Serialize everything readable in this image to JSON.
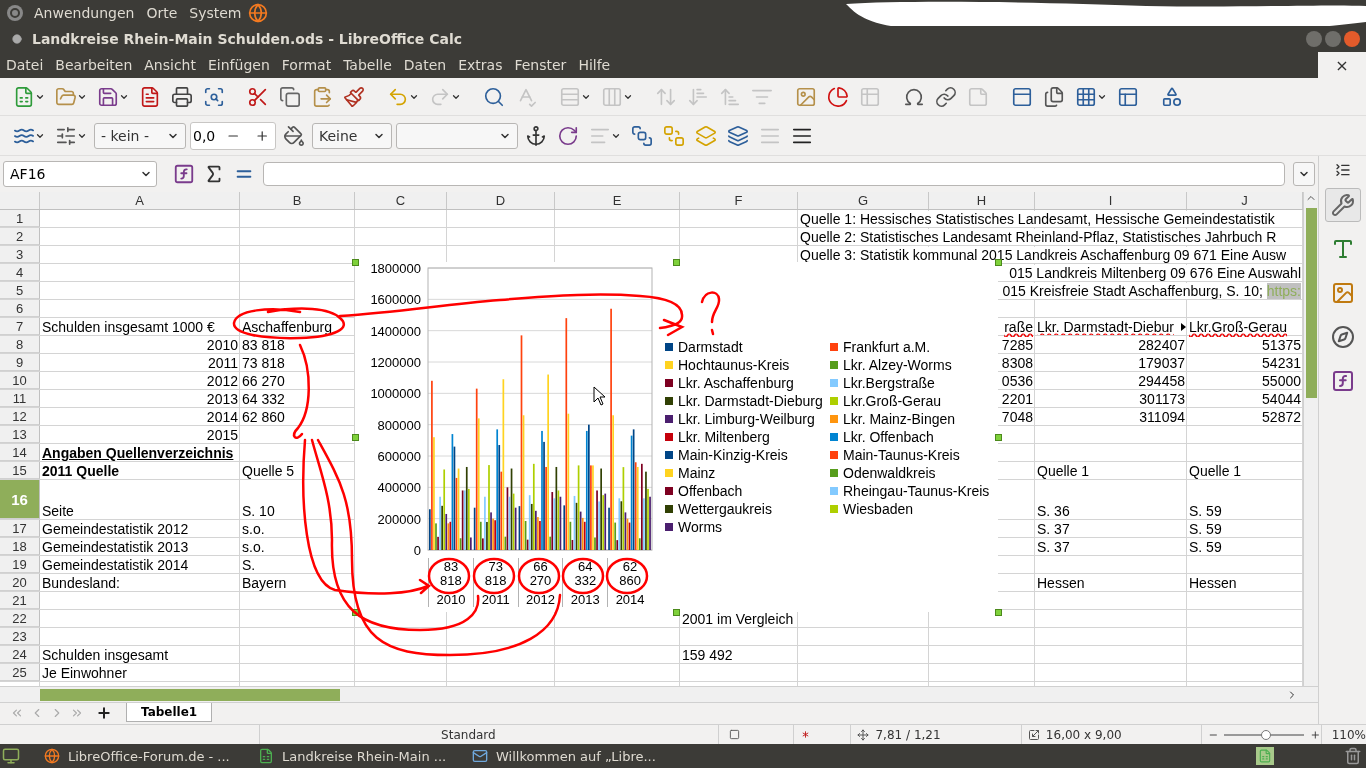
{
  "top_panel": {
    "menus": [
      "Anwendungen",
      "Orte",
      "System"
    ]
  },
  "window": {
    "title": "Landkreise Rhein-Main Schulden.ods - LibreOffice Calc",
    "close_document": "×"
  },
  "menu_bar": [
    "Datei",
    "Bearbeiten",
    "Ansicht",
    "Einfügen",
    "Format",
    "Tabelle",
    "Daten",
    "Extras",
    "Fenster",
    "Hilfe"
  ],
  "toolbar_standard": [
    {
      "disabled": false
    },
    {
      "disabled": false
    },
    {
      "disabled": false
    },
    {
      "disabled": false
    },
    {
      "disabled": false
    },
    {
      "disabled": false
    },
    {
      "disabled": false
    },
    {
      "disabled": false
    },
    {
      "disabled": false
    },
    {
      "disabled": false
    },
    {
      "disabled": false
    },
    {
      "disabled": true
    },
    {
      "disabled": false
    },
    {
      "disabled": true
    },
    {
      "disabled": true
    },
    {
      "disabled": true
    },
    {
      "disabled": true
    },
    {
      "disabled": true
    },
    {
      "disabled": true
    },
    {
      "disabled": true
    },
    {
      "disabled": false
    },
    {
      "disabled": false
    },
    {
      "disabled": true
    },
    {
      "disabled": false
    },
    {
      "disabled": false
    },
    {
      "disabled": true
    },
    {
      "disabled": false
    },
    {
      "disabled": false
    },
    {
      "disabled": false
    },
    {
      "disabled": false
    },
    {
      "disabled": false
    }
  ],
  "toolbar_drawing": [
    {
      "kind": "icon",
      "disabled": false
    },
    {
      "kind": "icon",
      "disabled": false
    },
    {
      "kind": "select",
      "value": "- kein -"
    },
    {
      "kind": "spin",
      "value": "0,0"
    },
    {
      "kind": "icon",
      "disabled": false
    },
    {
      "kind": "select",
      "value": "Keine"
    },
    {
      "kind": "select"
    },
    {
      "kind": "icon",
      "disabled": false
    },
    {
      "kind": "icon",
      "disabled": false
    },
    {
      "kind": "icon",
      "disabled": true
    },
    {
      "kind": "icon",
      "disabled": false
    },
    {
      "kind": "icon",
      "disabled": false
    },
    {
      "kind": "icon",
      "disabled": false
    },
    {
      "kind": "icon",
      "disabled": false
    },
    {
      "kind": "icon",
      "disabled": true
    },
    {
      "kind": "icon",
      "disabled": false
    }
  ],
  "formula_bar": {
    "cell_reference": "AF16"
  },
  "sidebar_decks": [
    {
      "selected": true
    },
    {
      "selected": false
    },
    {
      "selected": false
    },
    {
      "selected": false
    },
    {
      "selected": false
    }
  ],
  "sheet": {
    "columns": [
      "A",
      "B",
      "C",
      "D",
      "E",
      "F",
      "G",
      "H",
      "I",
      "J"
    ],
    "rows": [
      {
        "number": "1",
        "selected": false,
        "cells": {
          "G": {
            "text": "Quelle 1: Hessisches Statistisches Landesamt, Hessische Gemeindestatistik"
          }
        }
      },
      {
        "number": "2",
        "selected": false,
        "cells": {
          "G": {
            "text": "Quelle 2: Statistisches Landesamt Rheinland-Pflaz, Statistisches Jahrbuch R"
          }
        }
      },
      {
        "number": "3",
        "selected": false,
        "cells": {
          "G": {
            "text": "Quelle 3: Statistik kommunal 2015 Landkreis Aschaffenburg 09 671 Eine Ausw"
          }
        }
      },
      {
        "number": "4",
        "selected": false,
        "cells": {
          "J": {
            "right_aligned": true,
            "text": "015 Landkreis Miltenberg 09 676 Eine Auswahl"
          }
        }
      },
      {
        "number": "5",
        "selected": false,
        "cells": {
          "J": {
            "right_aligned": true,
            "text": "015 Kreisfreie Stadt Aschaffenburg, S. 10;",
            "link": "https:"
          }
        }
      },
      {
        "number": "6",
        "selected": false,
        "cells": {}
      },
      {
        "number": "7",
        "selected": false,
        "cells": {
          "A": {
            "text": "Schulden insgesamt 1000 €"
          },
          "B": {
            "text": "Aschaffenburg"
          },
          "H": {
            "right_aligned": true,
            "text": "raße",
            "spell_error": true
          },
          "I": {
            "text": "Lkr. Darmstadt-Diebur",
            "clipped": true,
            "spell_error": true
          },
          "J": {
            "text": "Lkr.Groß-Gerau",
            "spell_error": true
          }
        }
      },
      {
        "number": "8",
        "selected": false,
        "cells": {
          "A": {
            "right_aligned": true,
            "text": "2010"
          },
          "B": {
            "text": "83 818"
          },
          "H": {
            "right_aligned": true,
            "text": "7285"
          },
          "I": {
            "right_aligned": true,
            "text": "282407"
          },
          "J": {
            "right_aligned": true,
            "text": "51375"
          }
        }
      },
      {
        "number": "9",
        "selected": false,
        "cells": {
          "A": {
            "right_aligned": true,
            "text": "2011"
          },
          "B": {
            "text": "73 818"
          },
          "H": {
            "right_aligned": true,
            "text": "8308"
          },
          "I": {
            "right_aligned": true,
            "text": "179037"
          },
          "J": {
            "right_aligned": true,
            "text": "54231"
          }
        }
      },
      {
        "number": "10",
        "selected": false,
        "cells": {
          "A": {
            "right_aligned": true,
            "text": "2012"
          },
          "B": {
            "text": "66 270"
          },
          "H": {
            "right_aligned": true,
            "text": "0536"
          },
          "I": {
            "right_aligned": true,
            "text": "294458"
          },
          "J": {
            "right_aligned": true,
            "text": "55000"
          }
        }
      },
      {
        "number": "11",
        "selected": false,
        "cells": {
          "A": {
            "right_aligned": true,
            "text": "2013"
          },
          "B": {
            "text": "64 332"
          },
          "H": {
            "right_aligned": true,
            "text": "2201"
          },
          "I": {
            "right_aligned": true,
            "text": "301173"
          },
          "J": {
            "right_aligned": true,
            "text": "54044"
          }
        }
      },
      {
        "number": "12",
        "selected": false,
        "cells": {
          "A": {
            "right_aligned": true,
            "text": "2014"
          },
          "B": {
            "text": "62 860"
          },
          "H": {
            "right_aligned": true,
            "text": "7048"
          },
          "I": {
            "right_aligned": true,
            "text": "311094"
          },
          "J": {
            "right_aligned": true,
            "text": "52872"
          }
        }
      },
      {
        "number": "13",
        "selected": false,
        "cells": {
          "A": {
            "right_aligned": true,
            "text": "2015"
          }
        }
      },
      {
        "number": "14",
        "selected": false,
        "cells": {
          "A": {
            "text": "Angaben Quellenverzeichnis",
            "bold": true,
            "underline": true
          }
        }
      },
      {
        "number": "15",
        "selected": false,
        "cells": {
          "A": {
            "text": "2011 Quelle",
            "bold": true
          },
          "B": {
            "text": "Quelle 5"
          },
          "I": {
            "text": "Quelle 1"
          },
          "J": {
            "text": "Quelle 1"
          }
        }
      },
      {
        "number": "16",
        "selected": true,
        "tall": true,
        "cells": {
          "A": {
            "text": "Seite"
          },
          "B": {
            "text": "S. 10"
          },
          "I": {
            "text": "S. 36"
          },
          "J": {
            "text": "S. 59"
          }
        }
      },
      {
        "number": "17",
        "selected": false,
        "cells": {
          "A": {
            "text": "Gemeindestatistik 2012"
          },
          "B": {
            "text": "s.o."
          },
          "I": {
            "text": "S. 37"
          },
          "J": {
            "text": "S. 59"
          }
        }
      },
      {
        "number": "18",
        "selected": false,
        "cells": {
          "A": {
            "text": "Gemeindestatistik 2013"
          },
          "B": {
            "text": "s.o."
          },
          "I": {
            "text": "S. 37"
          },
          "J": {
            "text": "S. 59"
          }
        }
      },
      {
        "number": "19",
        "selected": false,
        "cells": {
          "A": {
            "text": "Gemeindestatistik 2014"
          },
          "B": {
            "text": "S."
          }
        }
      },
      {
        "number": "20",
        "selected": false,
        "cells": {
          "A": {
            "text": "Bundesland:"
          },
          "B": {
            "text": "Bayern"
          },
          "I": {
            "text": "Hessen"
          },
          "J": {
            "text": "Hessen"
          }
        }
      },
      {
        "number": "21",
        "selected": false,
        "cells": {}
      },
      {
        "number": "22",
        "selected": false,
        "cells": {
          "F": {
            "text": "2001 im Vergleich"
          }
        }
      },
      {
        "number": "23",
        "selected": false,
        "cells": {}
      },
      {
        "number": "24",
        "selected": false,
        "cells": {
          "A": {
            "text": "Schulden insgesamt"
          },
          "F": {
            "text": "159 492"
          }
        }
      },
      {
        "number": "25",
        "selected": false,
        "cells": {
          "A": {
            "text": "Je Einwohner"
          }
        }
      }
    ],
    "chart": {
      "category_notes": [
        "83 818",
        "73 818",
        "66 270",
        "64 332",
        "62 860"
      ],
      "chart_data": {
        "type": "bar",
        "legend": "right",
        "grid": true,
        "categories": [
          "2010",
          "2011",
          "2012",
          "2013",
          "2014"
        ],
        "ylim": [
          0,
          1800000
        ],
        "yticks": [
          0,
          200000,
          400000,
          600000,
          800000,
          1000000,
          1200000,
          1400000,
          1600000,
          1800000
        ],
        "series": [
          {
            "name": "Darmstadt",
            "color": "#004586",
            "values": [
              260000,
              270000,
              280000,
              285000,
              270000
            ]
          },
          {
            "name": "Frankfurt a.M.",
            "color": "#ff420e",
            "values": [
              1080000,
              1030000,
              1370000,
              1480000,
              1540000
            ]
          },
          {
            "name": "Hochtaunus-Kreis",
            "color": "#ffd320",
            "values": [
              720000,
              840000,
              860000,
              870000,
              860000
            ]
          },
          {
            "name": "Lkr. Alzey-Worms",
            "color": "#579d1c",
            "values": [
              170000,
              180000,
              185000,
              180000,
              175000
            ]
          },
          {
            "name": "Lkr. Aschaffenburg",
            "color": "#7e0021",
            "values": [
              84000,
              74000,
              66000,
              64000,
              63000
            ]
          },
          {
            "name": "Lkr.Bergstraße",
            "color": "#83caff",
            "values": [
              340000,
              340000,
              350000,
              345000,
              330000
            ]
          },
          {
            "name": "Lkr. Darmstadt-Dieburg",
            "color": "#314004",
            "values": [
              282000,
              179000,
              294000,
              301000,
              311000
            ]
          },
          {
            "name": "Lkr.Groß-Gerau",
            "color": "#aecf00",
            "values": [
              514000,
              542000,
              550000,
              540000,
              529000
            ]
          },
          {
            "name": "Lkr. Limburg-Weilburg",
            "color": "#4b1f6f",
            "values": [
              230000,
              240000,
              250000,
              245000,
              240000
            ]
          },
          {
            "name": "Lkr. Mainz-Bingen",
            "color": "#ff950e",
            "values": [
              170000,
              200000,
              210000,
              205000,
              200000
            ]
          },
          {
            "name": "Lkr. Miltenberg",
            "color": "#c5000b",
            "values": [
              180000,
              190000,
              185000,
              180000,
              175000
            ]
          },
          {
            "name": "Lkr. Offenbach",
            "color": "#0084d1",
            "values": [
              740000,
              770000,
              760000,
              760000,
              730000
            ]
          },
          {
            "name": "Main-Kinzig-Kreis",
            "color": "#004586",
            "values": [
              660000,
              670000,
              690000,
              800000,
              770000
            ]
          },
          {
            "name": "Main-Taunus-Kreis",
            "color": "#ff420e",
            "values": [
              460000,
              500000,
              530000,
              540000,
              560000
            ]
          },
          {
            "name": "Mainz",
            "color": "#ffd320",
            "values": [
              520000,
              1090000,
              1120000,
              540000,
              530000
            ]
          },
          {
            "name": "Odenwaldkreis",
            "color": "#579d1c",
            "values": [
              75000,
              85000,
              85000,
              80000,
              75000
            ]
          },
          {
            "name": "Offenbach",
            "color": "#7e0021",
            "values": [
              380000,
              400000,
              370000,
              380000,
              550000
            ]
          },
          {
            "name": "Rheingau-Taunus-Kreis",
            "color": "#83caff",
            "values": [
              380000,
              340000,
              330000,
              310000,
              330000
            ]
          },
          {
            "name": "Wettergaukreis",
            "color": "#314004",
            "values": [
              530000,
              520000,
              530000,
              520000,
              500000
            ]
          },
          {
            "name": "Wiesbaden",
            "color": "#aecf00",
            "values": [
              390000,
              360000,
              380000,
              350000,
              390000
            ]
          },
          {
            "name": "Worms",
            "color": "#4b1f6f",
            "values": [
              80000,
              270000,
              340000,
              360000,
              340000
            ]
          }
        ]
      }
    }
  },
  "sheet_tabs": [
    {
      "label": "Tabelle1",
      "selected": true
    }
  ],
  "status_bar": {
    "page_style": "Standard",
    "position": "7,81 / 1,21",
    "size": "16,00 x 9,00",
    "zoom": {
      "level": 0.52
    },
    "zoom_text": "110%"
  },
  "taskbar": [
    {
      "kind": "browser",
      "label": "LibreOffice-Forum.de - ..."
    },
    {
      "kind": "calc",
      "label": "Landkreise Rhein-Main ..."
    },
    {
      "kind": "mail",
      "label": "Willkommen auf „Libre..."
    }
  ]
}
